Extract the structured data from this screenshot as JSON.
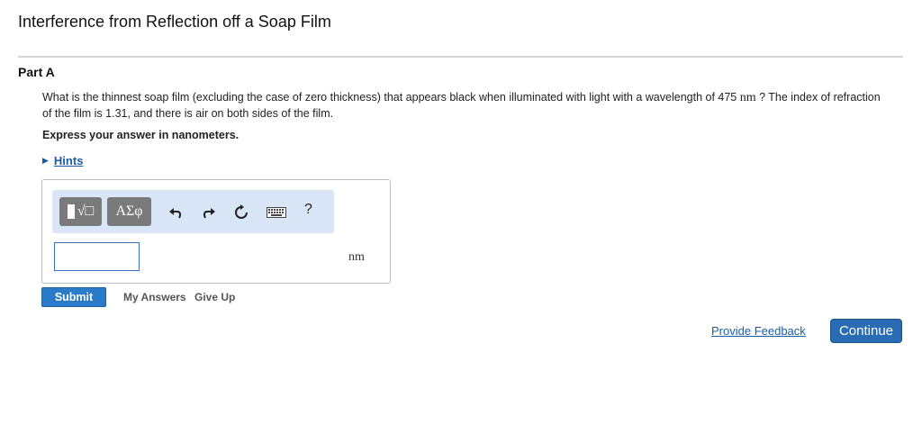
{
  "header": {
    "title": "Interference from Reflection off a Soap Film"
  },
  "part": {
    "label": "Part A"
  },
  "question": {
    "text_before": "What is the thinnest soap film (excluding the case of zero thickness) that appears black when illuminated with light with a wavelength of 475 ",
    "unit_inline": "nm",
    "text_after": " ? The index of refraction of the film is 1.31, and there is air on both sides of the film."
  },
  "instruction": "Express your answer in nanometers.",
  "hints": {
    "label": "Hints"
  },
  "toolbar": {
    "template_symbol": "√□",
    "greek_label": "ΑΣφ",
    "help_label": "?",
    "icons": [
      "templates-icon",
      "greek-symbols-icon",
      "undo-icon",
      "redo-icon",
      "reset-icon",
      "keyboard-icon",
      "help-icon"
    ]
  },
  "answer": {
    "value": "",
    "unit": "nm"
  },
  "actions": {
    "submit_label": "Submit",
    "my_answers_label": "My Answers",
    "give_up_label": "Give Up"
  },
  "footer": {
    "feedback_label": "Provide Feedback",
    "continue_label": "Continue"
  },
  "colors": {
    "accent_blue": "#2a7bc9",
    "link_blue": "#1a5da6",
    "toolbar_bg": "#d8e6f7",
    "button_gray": "#7a7a7a"
  }
}
